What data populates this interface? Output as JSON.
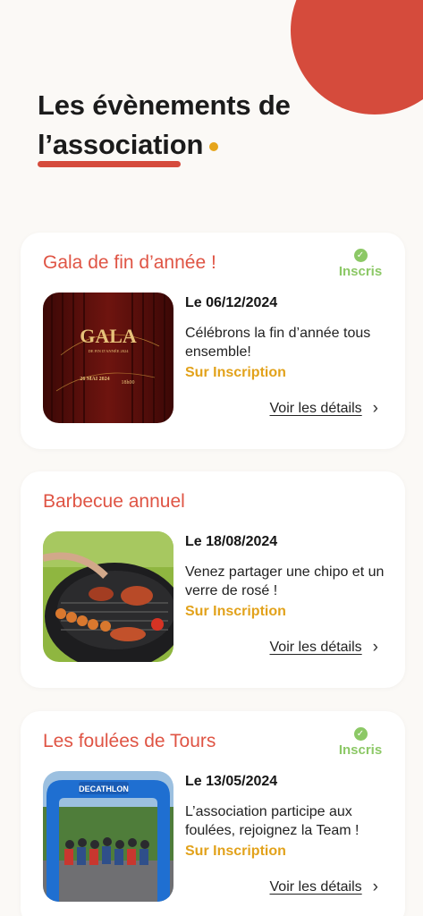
{
  "header": {
    "title_line1": "Les évènements de",
    "title_line2": "l’association"
  },
  "colors": {
    "accent_red": "#d54b3c",
    "event_title": "#df5444",
    "registered_green": "#8cc866",
    "registration_orange": "#e2a21b",
    "background": "#fbf9f6"
  },
  "events": [
    {
      "title": "Gala de fin d’année !",
      "status": "Inscris",
      "status_icon": "check-circle-icon",
      "date": "Le 06/12/2024",
      "description": "Célébrons la fin d’année tous ensemble!",
      "registration": "Sur Inscription",
      "details_label": "Voir les détails",
      "image": {
        "kind": "gala-poster",
        "headline": "GALA",
        "subline": "DE FIN D'ANNÉE 2024",
        "date_text": "26 MAI 2024",
        "time_text": "18h00"
      }
    },
    {
      "title": "Barbecue annuel",
      "status": "",
      "date": "Le 18/08/2024",
      "description": "Venez partager une chipo et un verre de rosé !",
      "registration": "Sur Inscription",
      "details_label": "Voir les détails",
      "image": {
        "kind": "barbecue-photo"
      }
    },
    {
      "title": "Les foulées de Tours",
      "status": "Inscris",
      "status_icon": "check-circle-icon",
      "date": "Le 13/05/2024",
      "description": "L’association participe aux foulées, rejoignez la Team !",
      "registration": "Sur Inscription",
      "details_label": "Voir les détails",
      "image": {
        "kind": "race-photo",
        "banner_text": "DECATHLON"
      }
    }
  ]
}
